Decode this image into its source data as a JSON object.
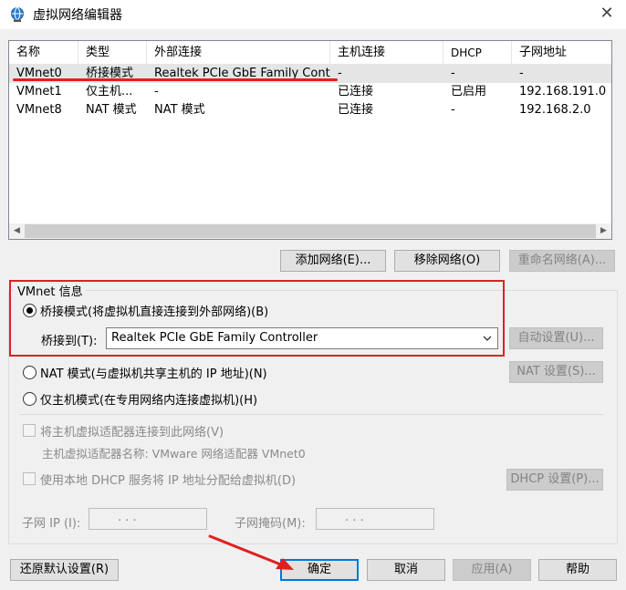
{
  "window": {
    "title": "虚拟网络编辑器",
    "close_glyph": "✕"
  },
  "list": {
    "columns": [
      "名称",
      "类型",
      "外部连接",
      "主机连接",
      "DHCP",
      "子网地址"
    ],
    "rows": [
      {
        "name": "VMnet0",
        "type": "桥接模式",
        "external": "Realtek PCIe GbE Family Contr...",
        "host": "-",
        "dhcp": "-",
        "subnet": "-"
      },
      {
        "name": "VMnet1",
        "type": "仅主机...",
        "external": "-",
        "host": "已连接",
        "dhcp": "已启用",
        "subnet": "192.168.191.0"
      },
      {
        "name": "VMnet8",
        "type": "NAT 模式",
        "external": "NAT 模式",
        "host": "已连接",
        "dhcp": "-",
        "subnet": "192.168.2.0"
      }
    ]
  },
  "buttons": {
    "add_network": "添加网络(E)...",
    "remove_network": "移除网络(O)",
    "rename_network": "重命名网络(A)...",
    "auto_settings": "自动设置(U)...",
    "nat_settings": "NAT 设置(S)...",
    "dhcp_settings": "DHCP 设置(P)...",
    "restore_defaults": "还原默认设置(R)",
    "ok": "确定",
    "cancel": "取消",
    "apply": "应用(A)",
    "help": "帮助"
  },
  "vmnet_info": {
    "group_label": "VMnet 信息",
    "bridged_label": "桥接模式(将虚拟机直接连接到外部网络)(B)",
    "bridge_to_label": "桥接到(T):",
    "bridge_to_value": "Realtek PCIe GbE Family Controller",
    "nat_label": "NAT 模式(与虚拟机共享主机的 IP 地址)(N)",
    "host_only_label": "仅主机模式(在专用网络内连接虚拟机)(H)",
    "connect_adapter_label": "将主机虚拟适配器连接到此网络(V)",
    "adapter_name_label": "主机虚拟适配器名称: VMware 网络适配器 VMnet0",
    "dhcp_label": "使用本地 DHCP 服务将 IP 地址分配给虚拟机(D)",
    "subnet_ip_label": "子网 IP (I):",
    "subnet_mask_label": "子网掩码(M):",
    "ip_dots": ".   .   ."
  },
  "colors": {
    "annotation_red": "#e02020",
    "focus_blue": "#0078d7"
  }
}
